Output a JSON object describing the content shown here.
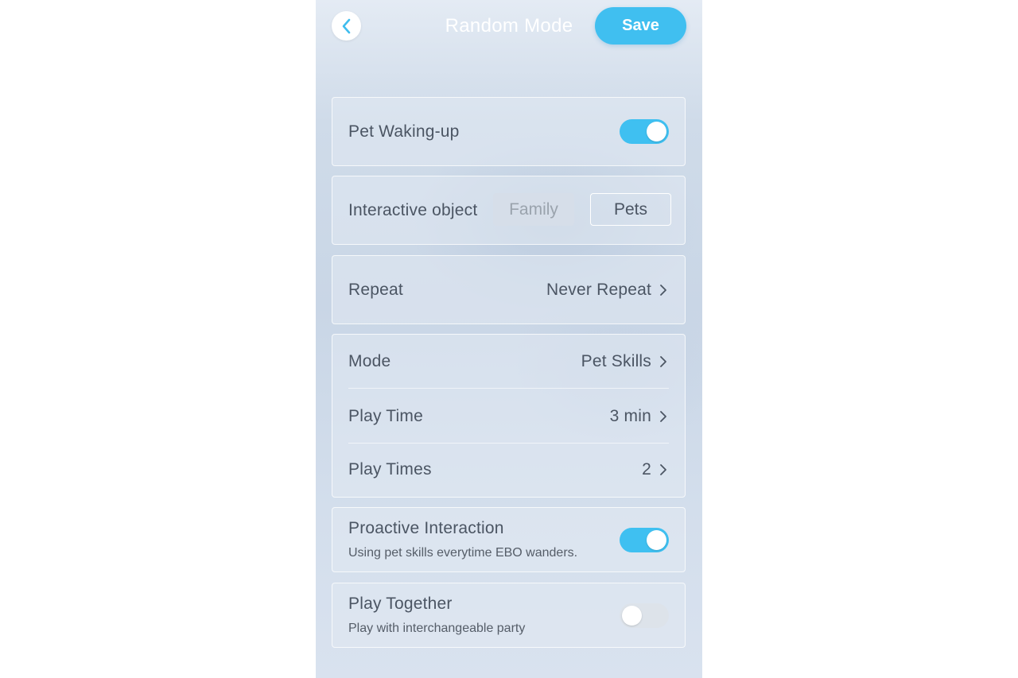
{
  "header": {
    "title": "Random Mode",
    "save_label": "Save"
  },
  "pet_waking_up": {
    "label": "Pet Waking-up",
    "enabled": true
  },
  "interactive_object": {
    "label": "Interactive object",
    "options": [
      "Family",
      "Pets"
    ],
    "selected": "Pets"
  },
  "repeat": {
    "label": "Repeat",
    "value": "Never Repeat"
  },
  "mode_group": {
    "mode": {
      "label": "Mode",
      "value": "Pet Skills"
    },
    "play_time": {
      "label": "Play Time",
      "value": "3 min"
    },
    "play_times": {
      "label": "Play Times",
      "value": "2"
    }
  },
  "proactive_interaction": {
    "title": "Proactive Interaction",
    "description": "Using pet skills everytime EBO wanders.",
    "enabled": true
  },
  "play_together": {
    "title": "Play Together",
    "description": "Play with interchangeable party",
    "enabled": false
  },
  "colors": {
    "accent": "#40bff0",
    "text": "#4b5563",
    "toggle_off": "#dde3ea"
  },
  "icons": {
    "back": "chevron-left-icon",
    "disclosure": "chevron-right-icon"
  }
}
